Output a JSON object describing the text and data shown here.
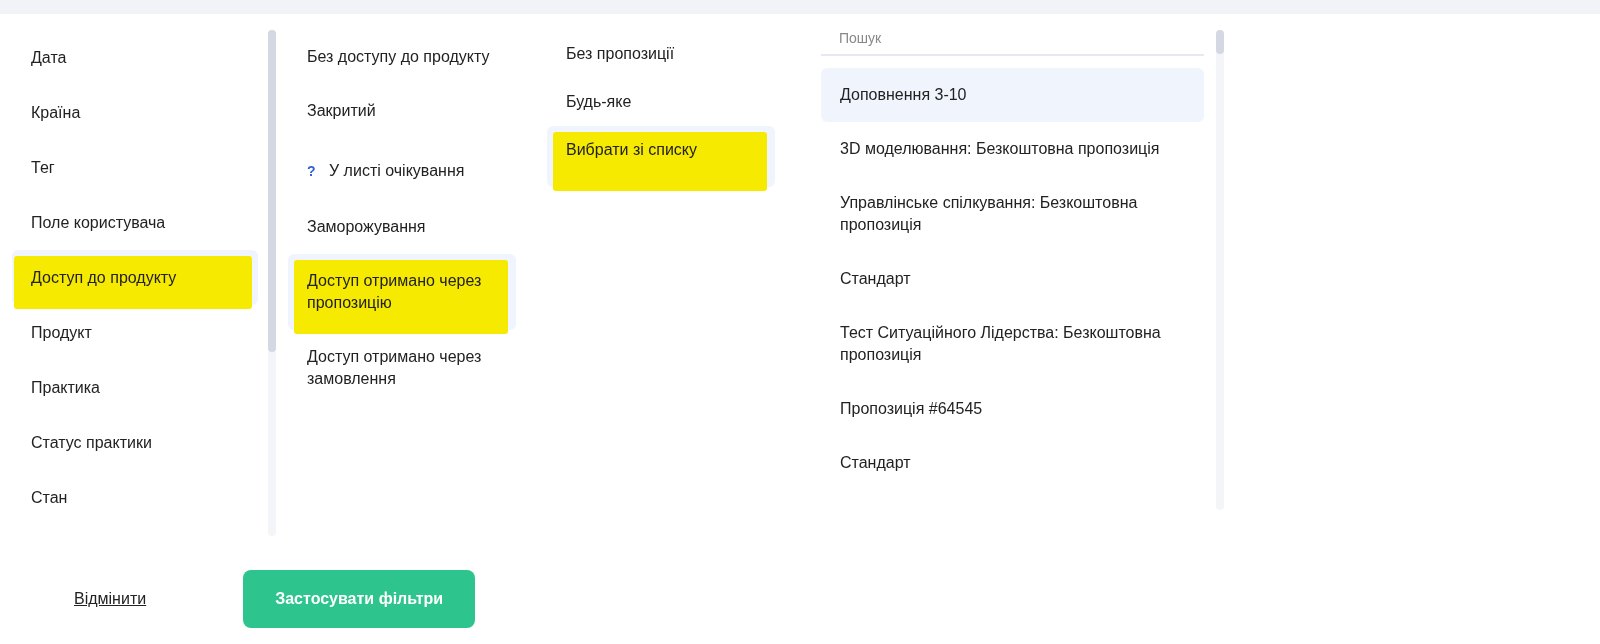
{
  "categories": [
    {
      "label": "Дата",
      "selected": false,
      "highlighted": false
    },
    {
      "label": "Країна",
      "selected": false,
      "highlighted": false
    },
    {
      "label": "Тег",
      "selected": false,
      "highlighted": false
    },
    {
      "label": "Поле користувача",
      "selected": false,
      "highlighted": false
    },
    {
      "label": "Доступ до продукту",
      "selected": true,
      "highlighted": true
    },
    {
      "label": "Продукт",
      "selected": false,
      "highlighted": false
    },
    {
      "label": "Практика",
      "selected": false,
      "highlighted": false
    },
    {
      "label": "Статус практики",
      "selected": false,
      "highlighted": false
    },
    {
      "label": "Стан",
      "selected": false,
      "highlighted": false
    }
  ],
  "access_options": [
    {
      "label": "Без доступу до продукту",
      "selected": false,
      "highlighted": false
    },
    {
      "label": "Закритий",
      "selected": false,
      "highlighted": false
    },
    {
      "label": "У листі очікування",
      "icon": "?",
      "selected": false,
      "highlighted": false
    },
    {
      "label": "Заморожування",
      "selected": false,
      "highlighted": false
    },
    {
      "label": "Доступ отримано через пропозицію",
      "selected": true,
      "highlighted": true
    },
    {
      "label": "Доступ отримано через замовлення",
      "selected": false,
      "highlighted": false
    }
  ],
  "offer_options": [
    {
      "label": "Без пропозиції",
      "selected": false,
      "highlighted": false
    },
    {
      "label": "Будь-яке",
      "selected": false,
      "highlighted": false
    },
    {
      "label": "Вибрати зі списку",
      "selected": true,
      "highlighted": true
    }
  ],
  "offer_list": {
    "search": {
      "placeholder": "Пошук"
    },
    "items": [
      {
        "label": "Доповнення 3-10",
        "selected": true
      },
      {
        "label": "3D моделювання: Безкоштовна пропозиція",
        "selected": false
      },
      {
        "label": "Управлінське спілкування: Безкоштовна пропозиція",
        "selected": false
      },
      {
        "label": "Стандарт",
        "selected": false
      },
      {
        "label": "Тест Ситуаційного Лідерства: Безкоштовна пропозиція",
        "selected": false
      },
      {
        "label": "Пропозиція #64545",
        "selected": false
      },
      {
        "label": "Стандарт",
        "selected": false
      }
    ]
  },
  "buttons": {
    "cancel": "Відмінити",
    "apply": "Застосувати фільтри"
  }
}
